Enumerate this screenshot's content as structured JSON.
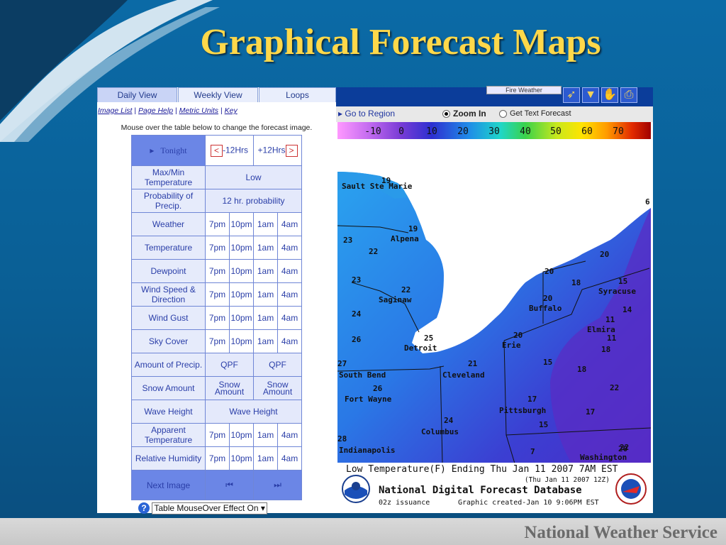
{
  "slide": {
    "title": "Graphical Forecast Maps",
    "footer": "National Weather Service"
  },
  "tabs": [
    "Daily View",
    "Weekly View",
    "Loops"
  ],
  "links": [
    "Image List",
    "Page Help",
    "Metric Units",
    "Key"
  ],
  "instruction": "Mouse over the table below to change the forecast image.",
  "table": {
    "tonight": "Tonight",
    "minus12": "-12Hrs",
    "plus12": "+12Hrs",
    "times": [
      "7pm",
      "10pm",
      "1am",
      "4am"
    ],
    "rows": [
      {
        "label": "Max/Min Temperature",
        "kind": "wide",
        "value": "Low"
      },
      {
        "label": "Probability of Precip.",
        "kind": "wide",
        "value": "12 hr. probability"
      },
      {
        "label": "Weather",
        "kind": "times"
      },
      {
        "label": "Temperature",
        "kind": "times"
      },
      {
        "label": "Dewpoint",
        "kind": "times"
      },
      {
        "label": "Wind Speed & Direction",
        "kind": "times"
      },
      {
        "label": "Wind Gust",
        "kind": "times"
      },
      {
        "label": "Sky Cover",
        "kind": "times"
      },
      {
        "label": "Amount of Precip.",
        "kind": "half",
        "values": [
          "QPF",
          "QPF"
        ]
      },
      {
        "label": "Snow Amount",
        "kind": "half",
        "values": [
          "Snow Amount",
          "Snow Amount"
        ]
      },
      {
        "label": "Wave Height",
        "kind": "wide",
        "value": "Wave Height"
      },
      {
        "label": "Apparent Temperature",
        "kind": "times"
      },
      {
        "label": "Relative Humidity",
        "kind": "times"
      }
    ],
    "next_image": "Next Image"
  },
  "mouseover_select": "Table MouseOver Effect On",
  "map_toolbar": {
    "fire_weather": "Fire Weather",
    "go_to_region": "Go to Region",
    "zoom_in": "Zoom In",
    "get_text": "Get Text Forecast",
    "selected_mode": "Zoom In"
  },
  "scale_ticks": [
    "-10",
    "0",
    "10",
    "20",
    "30",
    "40",
    "50",
    "60",
    "70"
  ],
  "map": {
    "cities": [
      {
        "name": "Sault Ste Marie",
        "value": "19"
      },
      {
        "name": "Alpena",
        "value": "19"
      },
      {
        "name": "Saginaw",
        "value": "22"
      },
      {
        "name": "Detroit",
        "value": "25"
      },
      {
        "name": "South Bend",
        "value": "27"
      },
      {
        "name": "Fort Wayne",
        "value": "26"
      },
      {
        "name": "Cleveland",
        "value": "21"
      },
      {
        "name": "Columbus",
        "value": "24"
      },
      {
        "name": "Indianapolis",
        "value": "28"
      },
      {
        "name": "Buffalo",
        "value": "20"
      },
      {
        "name": "Erie",
        "value": "20"
      },
      {
        "name": "Elmira",
        "value": "11"
      },
      {
        "name": "Syracuse",
        "value": "15"
      },
      {
        "name": "Pittsburgh",
        "value": "17"
      },
      {
        "name": "Washington",
        "value": "22"
      }
    ],
    "other_values": [
      "23",
      "22",
      "23",
      "24",
      "26",
      "20",
      "20",
      "18",
      "14",
      "11",
      "18",
      "15",
      "18",
      "22",
      "17",
      "15",
      "7",
      "20",
      "6"
    ]
  },
  "legend": {
    "line1": "Low Temperature(F) Ending Thu Jan 11 2007  7AM EST",
    "line2": "(Thu Jan 11 2007 12Z)",
    "line3": "National Digital Forecast Database",
    "line4": "02z issuance",
    "line5": "Graphic created-Jan 10  9:06PM EST"
  },
  "colors": {
    "title": "#ffd84a",
    "table_border": "#6f86d6",
    "selected_cell": "#6b86e6",
    "lake": "#ffffff"
  }
}
